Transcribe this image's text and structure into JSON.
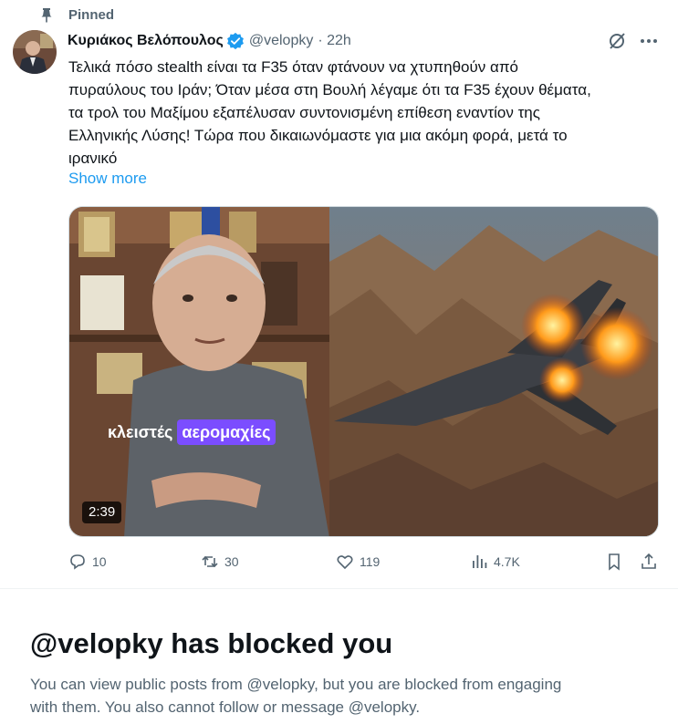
{
  "pinned": {
    "label": "Pinned",
    "icon": "pin-icon"
  },
  "tweet": {
    "author": {
      "name": "Κυριάκος Βελόπουλος",
      "handle": "@velopky",
      "time": "· 22h",
      "verified_color": "#1d9bf0"
    },
    "text_lines": [
      "Τελικά πόσο stealth είναι τα F35 όταν φτάνουν να χτυπηθούν από",
      "πυραύλους του Ιράν; Όταν μέσα στη Βουλή λέγαμε ότι τα F35 έχουν θέματα,",
      "τα τρολ του Μαξίμου εξαπέλυσαν συντονισμένη επίθεση εναντίον της",
      "Ελληνικής Λύσης! Τώρα που δικαιωνόμαστε για μια ακόμη φορά, μετά το",
      "ιρανικό"
    ],
    "show_more": "Show more",
    "media": {
      "caption_plain": "κλειστές",
      "caption_highlight": "αερομαχίες",
      "duration": "2:39",
      "caption_highlight_color": "#7b4dff"
    },
    "actions": {
      "replies": "10",
      "reposts": "30",
      "likes": "119",
      "views": "4.7K"
    },
    "icons": [
      "grok-icon",
      "more-icon",
      "reply-icon",
      "repost-icon",
      "like-icon",
      "views-icon",
      "bookmark-icon",
      "share-icon"
    ]
  },
  "blocked": {
    "title": "@velopky has blocked you",
    "lines": [
      "You can view public posts from @velopky, but you are blocked from engaging",
      "with them. You also cannot follow or message @velopky."
    ]
  },
  "colors": {
    "accent": "#1d9bf0",
    "text": "#0f1419",
    "secondary": "#536471"
  }
}
